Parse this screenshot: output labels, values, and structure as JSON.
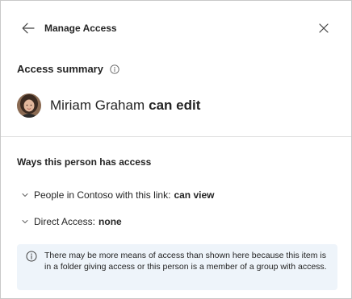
{
  "header": {
    "title": "Manage Access",
    "back_icon": "arrow-left-icon",
    "close_icon": "close-icon"
  },
  "summary": {
    "label": "Access summary",
    "info_icon": "info-icon",
    "person_name": "Miriam Graham",
    "permission": "can edit",
    "avatar_icon": "user-avatar"
  },
  "ways": {
    "title": "Ways this person has access",
    "items": [
      {
        "label": "People in Contoso with this link:",
        "value": "can view",
        "icon": "chevron-down-icon"
      },
      {
        "label": "Direct Access:",
        "value": "none",
        "icon": "chevron-down-icon"
      }
    ]
  },
  "notice": {
    "icon": "info-icon",
    "text": "There may be more means of access than shown here because this item is in a folder giving access or this person is a member of a group with access."
  },
  "colors": {
    "notice_bg": "#eef4fa",
    "divider": "#e1e1e1",
    "text": "#242424"
  }
}
